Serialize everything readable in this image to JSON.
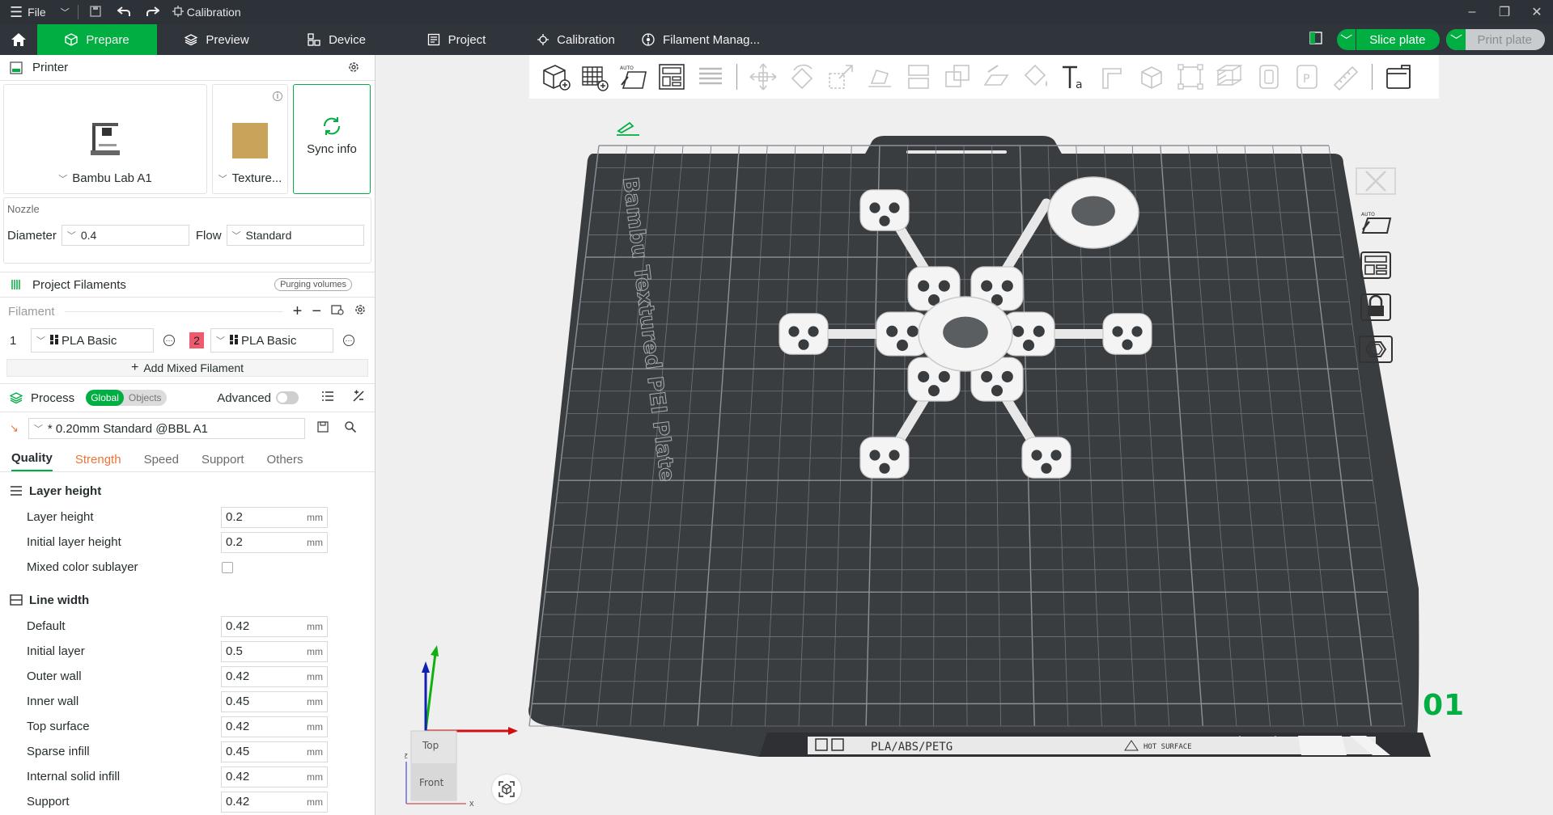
{
  "titlebar": {
    "file_label": "File",
    "title": "Calibration"
  },
  "tabs": [
    {
      "label": "Prepare",
      "icon": "cube-icon"
    },
    {
      "label": "Preview",
      "icon": "layers-icon"
    },
    {
      "label": "Device",
      "icon": "device-icon"
    },
    {
      "label": "Project",
      "icon": "project-icon"
    },
    {
      "label": "Calibration",
      "icon": "calibration-icon"
    },
    {
      "label": "Filament Manag...",
      "icon": "filament-icon"
    }
  ],
  "actions": {
    "slice_label": "Slice plate",
    "print_label": "Print plate"
  },
  "printer": {
    "section_title": "Printer",
    "printer_name": "Bambu Lab A1",
    "plate_name": "Texture...",
    "sync_label": "Sync info",
    "nozzle_title": "Nozzle",
    "diameter_label": "Diameter",
    "diameter_value": "0.4",
    "flow_label": "Flow",
    "flow_value": "Standard"
  },
  "filaments": {
    "section_title": "Project Filaments",
    "purging_label": "Purging volumes",
    "filament_label": "Filament",
    "items": [
      {
        "num": "1",
        "name": "PLA Basic"
      },
      {
        "num": "2",
        "name": "PLA Basic",
        "color": "#f05a6e"
      }
    ],
    "add_mixed_label": "Add Mixed Filament"
  },
  "process": {
    "section_title": "Process",
    "global_label": "Global",
    "objects_label": "Objects",
    "advanced_label": "Advanced",
    "preset_value": "* 0.20mm Standard @BBL A1",
    "subtabs": [
      "Quality",
      "Strength",
      "Speed",
      "Support",
      "Others"
    ],
    "layer_height_group": "Layer height",
    "layer_params": [
      {
        "name": "Layer height",
        "value": "0.2",
        "unit": "mm"
      },
      {
        "name": "Initial layer height",
        "value": "0.2",
        "unit": "mm"
      }
    ],
    "mixed_sublayer_label": "Mixed color sublayer",
    "line_width_group": "Line width",
    "line_params": [
      {
        "name": "Default",
        "value": "0.42",
        "unit": "mm"
      },
      {
        "name": "Initial layer",
        "value": "0.5",
        "unit": "mm"
      },
      {
        "name": "Outer wall",
        "value": "0.42",
        "unit": "mm"
      },
      {
        "name": "Inner wall",
        "value": "0.45",
        "unit": "mm"
      },
      {
        "name": "Top surface",
        "value": "0.42",
        "unit": "mm"
      },
      {
        "name": "Sparse infill",
        "value": "0.45",
        "unit": "mm"
      },
      {
        "name": "Internal solid infill",
        "value": "0.42",
        "unit": "mm"
      },
      {
        "name": "Support",
        "value": "0.42",
        "unit": "mm"
      }
    ]
  },
  "viewport": {
    "plate_text": "Bambu Textured PEI Plate",
    "plate_strip": "PLA/ABS/PETG",
    "hot_surface": "HOT SURFACE",
    "plate_number": "01",
    "cube_top": "Top",
    "cube_front": "Front",
    "axis_z": "z",
    "axis_x": "x"
  },
  "colors": {
    "accent": "#00ae42",
    "plate": "#3d4043",
    "modified": "#ef7234"
  }
}
